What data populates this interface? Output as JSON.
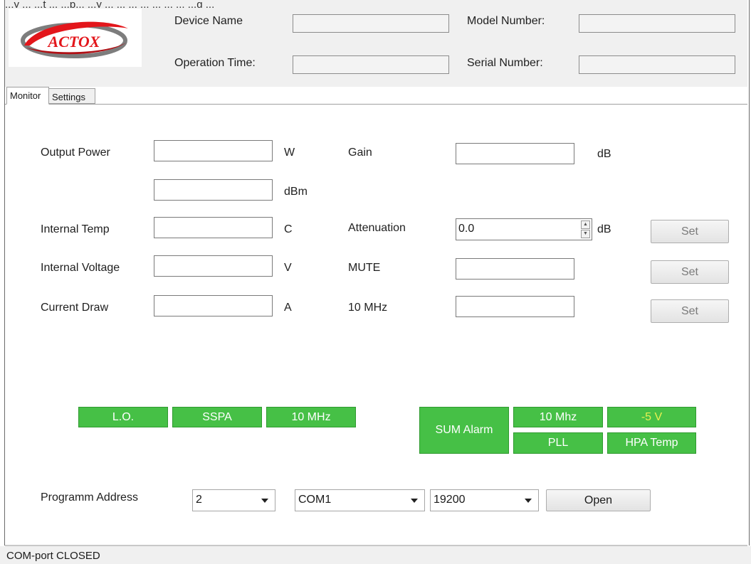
{
  "top_overflow_text": "...y ...       ...t ... ...p... ...y ...  ... ... ... ... ... ... ...g ...",
  "header": {
    "device_name_label": "Device Name",
    "operation_time_label": "Operation Time:",
    "model_number_label": "Model Number:",
    "serial_number_label": "Serial Number:",
    "device_name_value": "",
    "operation_time_value": "",
    "model_number_value": "",
    "serial_number_value": "",
    "logo_text": "ACTOX",
    "logo_colors": {
      "swoosh": "#e3161b",
      "gray": "#7d7d7d"
    }
  },
  "tabs": [
    {
      "label": "Monitor",
      "active": true
    },
    {
      "label": "Settings",
      "active": false
    }
  ],
  "monitor": {
    "output_power_label": "Output Power",
    "unit_w": "W",
    "unit_dbm": "dBm",
    "gain_label": "Gain",
    "gain_unit": "dB",
    "internal_temp_label": "Internal Temp",
    "unit_c": "C",
    "attenuation_label": "Attenuation",
    "attenuation_value": "0.0",
    "attenuation_unit": "dB",
    "internal_voltage_label": "Internal Voltage",
    "unit_v": "V",
    "mute_label": "MUTE",
    "current_draw_label": "Current Draw",
    "unit_a": "A",
    "ten_mhz_label": "10 MHz",
    "set_label": "Set"
  },
  "indicators": {
    "lo": "L.O.",
    "sspa": "SSPA",
    "ten_mhz": "10 MHz",
    "sum_alarm": "SUM Alarm",
    "ten_mhz_b": "10 Mhz",
    "minus_5v": "-5 V",
    "pll": "PLL",
    "hpa_temp": "HPA Temp",
    "colors": {
      "ok": "#46c046",
      "warn_text": "#e9f051"
    }
  },
  "connection": {
    "address_label": "Programm Address",
    "address_value": "2",
    "port_value": "COM1",
    "baud_value": "19200",
    "open_label": "Open"
  },
  "status_bar": {
    "text": "COM-port CLOSED"
  }
}
